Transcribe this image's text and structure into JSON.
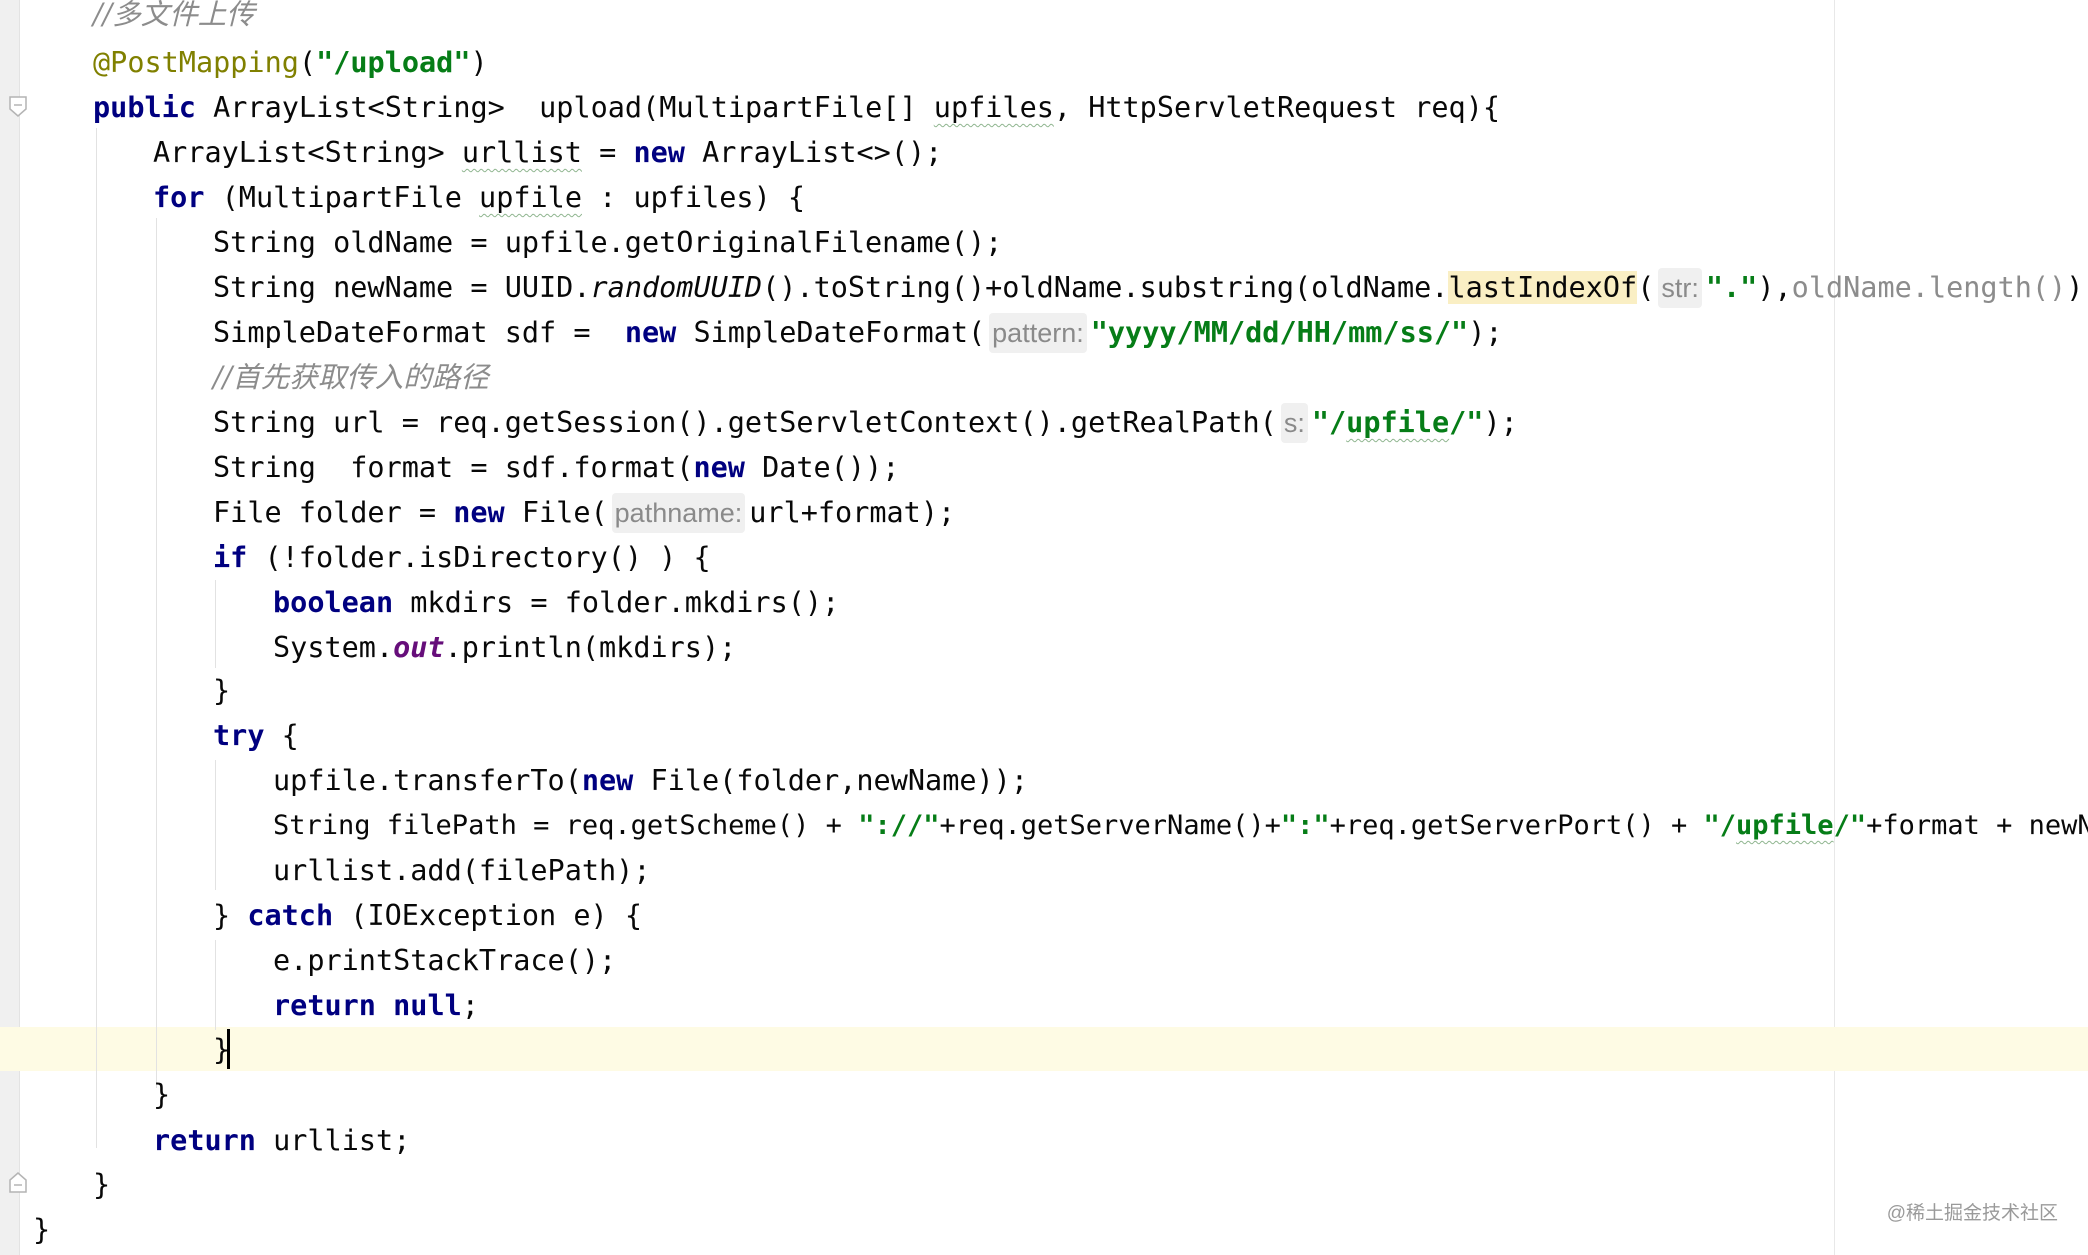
{
  "colors": {
    "keyword": "#000080",
    "string": "#067d17",
    "comment": "#8c8c8c",
    "annotation": "#808000",
    "caret_line": "#fefbe4",
    "highlight": "#faefc4"
  },
  "icons": {
    "fold_start": "fold-open-icon",
    "fold_end": "fold-close-icon"
  },
  "code": {
    "l01": {
      "comment": "//多文件上传"
    },
    "l02": {
      "annotation": "@PostMapping",
      "open": "(",
      "str": "\"/upload\"",
      "close": ")"
    },
    "l03": {
      "kw": "public",
      "t1": " ArrayList<String>  upload(MultipartFile[] ",
      "sq": "upfiles",
      "t2": ", HttpServletRequest req){"
    },
    "l04": {
      "t1": "ArrayList<String> ",
      "sq": "urllist",
      "t2": " = ",
      "kw": "new",
      "t3": " ArrayList<>();"
    },
    "l05": {
      "kw": "for",
      "t1": " (MultipartFile ",
      "sq": "upfile",
      "t2": " : upfiles) {"
    },
    "l06": {
      "t1": "String oldName = upfile.getOriginalFilename();"
    },
    "l07": {
      "t1": "String newName = UUID.",
      "ital": "randomUUID",
      "t2": "().toString()+oldName.substring(oldName.",
      "hl": "lastIndexOf",
      "t3": "(",
      "hint": "str:",
      "str": "\".\"",
      "t4": "),",
      "dim": "oldName.length()",
      "t5": ");"
    },
    "l08": {
      "t1": "SimpleDateFormat sdf =  ",
      "kw": "new",
      "t2": " SimpleDateFormat(",
      "hint": "pattern:",
      "str": "\"yyyy/MM/dd/HH/mm/ss/\"",
      "t3": ");"
    },
    "l09": {
      "comment": "//首先获取传入的路径"
    },
    "l10": {
      "t1": "String url = req.getSession().getServletContext().getRealPath(",
      "hint": "s:",
      "str1": "\"/",
      "sq": "upfile",
      "str2": "/\"",
      "t2": ");"
    },
    "l11": {
      "t1": "String  format = sdf.format(",
      "kw": "new",
      "t2": " Date());"
    },
    "l12": {
      "t1": "File folder = ",
      "kw": "new",
      "t2": " File(",
      "hint": "pathname:",
      "t3": "url+format);"
    },
    "l13": {
      "kw": "if",
      "t1": " (!folder.isDirectory() ) {"
    },
    "l14": {
      "kw": "boolean",
      "t1": " mkdirs = folder.mkdirs();"
    },
    "l15": {
      "t1": "System.",
      "fld": "out",
      "t2": ".println(mkdirs);"
    },
    "l16": {
      "t1": "}"
    },
    "l17": {
      "kw": "try",
      "t1": " {"
    },
    "l18": {
      "t1": "upfile.transferTo(",
      "kw": "new",
      "t2": " File(folder,newName));"
    },
    "l19": {
      "t1": "String filePath = req.getScheme() + ",
      "s1": "\"://\"",
      "t2": "+req.getServerName()+",
      "s2": "\":\"",
      "t3": "+req.getServerPort() + ",
      "s3a": "\"/",
      "sq": "upfile",
      "s3b": "/\"",
      "t4": "+format + newName;"
    },
    "l20": {
      "t1": "urllist.add(filePath);"
    },
    "l21": {
      "t1": "} ",
      "kw": "catch",
      "t2": " (IOException e) {"
    },
    "l22": {
      "t1": "e.printStackTrace();"
    },
    "l23": {
      "kw1": "return",
      "sp": " ",
      "kw2": "null",
      "t1": ";"
    },
    "l24": {
      "t1": "}"
    },
    "l25": {
      "t1": "}"
    },
    "l26": {
      "kw": "return",
      "t1": " urllist;"
    },
    "l27": {
      "t1": "}"
    },
    "l28": {
      "t1": "}"
    }
  },
  "watermark": "@稀土掘金技术社区"
}
